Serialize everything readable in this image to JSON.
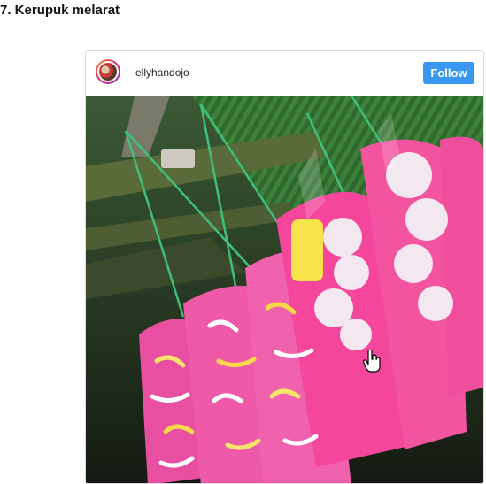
{
  "article": {
    "heading": "7. Kerupuk melarat"
  },
  "instagram_embed": {
    "username": "ellyhandojo",
    "follow_label": "Follow",
    "accent_color": "#3897f0",
    "avatar_icon": "profile-avatar",
    "photo_subject": "bags of colorful kerupuk crackers hanging from a rafter"
  }
}
